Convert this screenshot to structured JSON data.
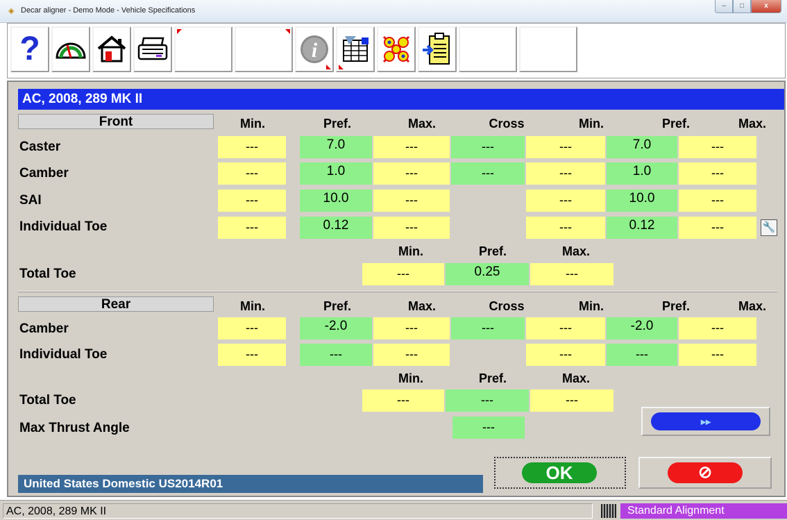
{
  "window": {
    "title": "Decar aligner - Demo Mode  -  Vehicle Specifications",
    "minimize": "–",
    "maximize": "□",
    "close": "x"
  },
  "toolbar": {
    "buttons": [
      {
        "icon": "help-icon"
      },
      {
        "icon": "gauge-icon"
      },
      {
        "icon": "home-icon"
      },
      {
        "icon": "printer-icon"
      },
      {
        "icon": "blank-button"
      },
      {
        "icon": "blank-button"
      },
      {
        "icon": "info-icon"
      },
      {
        "icon": "spreadsheet-icon"
      },
      {
        "icon": "pattern-icon"
      },
      {
        "icon": "clipboard-import-icon"
      },
      {
        "icon": "blank-button"
      },
      {
        "icon": "blank-button"
      }
    ]
  },
  "vehicle": "AC, 2008, 289 MK II",
  "columns": {
    "min": "Min.",
    "pref": "Pref.",
    "max": "Max.",
    "cross": "Cross"
  },
  "front": {
    "header": "Front",
    "rows": [
      {
        "label": "Caster",
        "left": [
          "---",
          "7.0",
          "---"
        ],
        "cross": "---",
        "right": [
          "---",
          "7.0",
          "---"
        ]
      },
      {
        "label": "Camber",
        "left": [
          "---",
          "1.0",
          "---"
        ],
        "cross": "---",
        "right": [
          "---",
          "1.0",
          "---"
        ]
      },
      {
        "label": "SAI",
        "left": [
          "---",
          "10.0",
          "---"
        ],
        "right": [
          "---",
          "10.0",
          "---"
        ]
      },
      {
        "label": "Individual Toe",
        "left": [
          "---",
          "0.12",
          "---"
        ],
        "right": [
          "---",
          "0.12",
          "---"
        ]
      }
    ],
    "total_toe": {
      "label": "Total Toe",
      "values": [
        "---",
        "0.25",
        "---"
      ]
    }
  },
  "rear": {
    "header": "Rear",
    "rows": [
      {
        "label": "Camber",
        "left": [
          "---",
          "-2.0",
          "---"
        ],
        "cross": "---",
        "right": [
          "---",
          "-2.0",
          "---"
        ]
      },
      {
        "label": "Individual Toe",
        "left": [
          "---",
          "---",
          "---"
        ],
        "right": [
          "---",
          "---",
          "---"
        ]
      }
    ],
    "total_toe": {
      "label": "Total Toe",
      "values": [
        "---",
        "---",
        "---"
      ]
    },
    "max_thrust": {
      "label": "Max Thrust Angle",
      "value": "---"
    }
  },
  "buttons": {
    "next": "▸▸",
    "ok": "OK",
    "cancel": "⊘"
  },
  "database": "United States Domestic US2014R01",
  "status": {
    "left": "AC, 2008, 289 MK II",
    "right": "Standard Alignment"
  }
}
